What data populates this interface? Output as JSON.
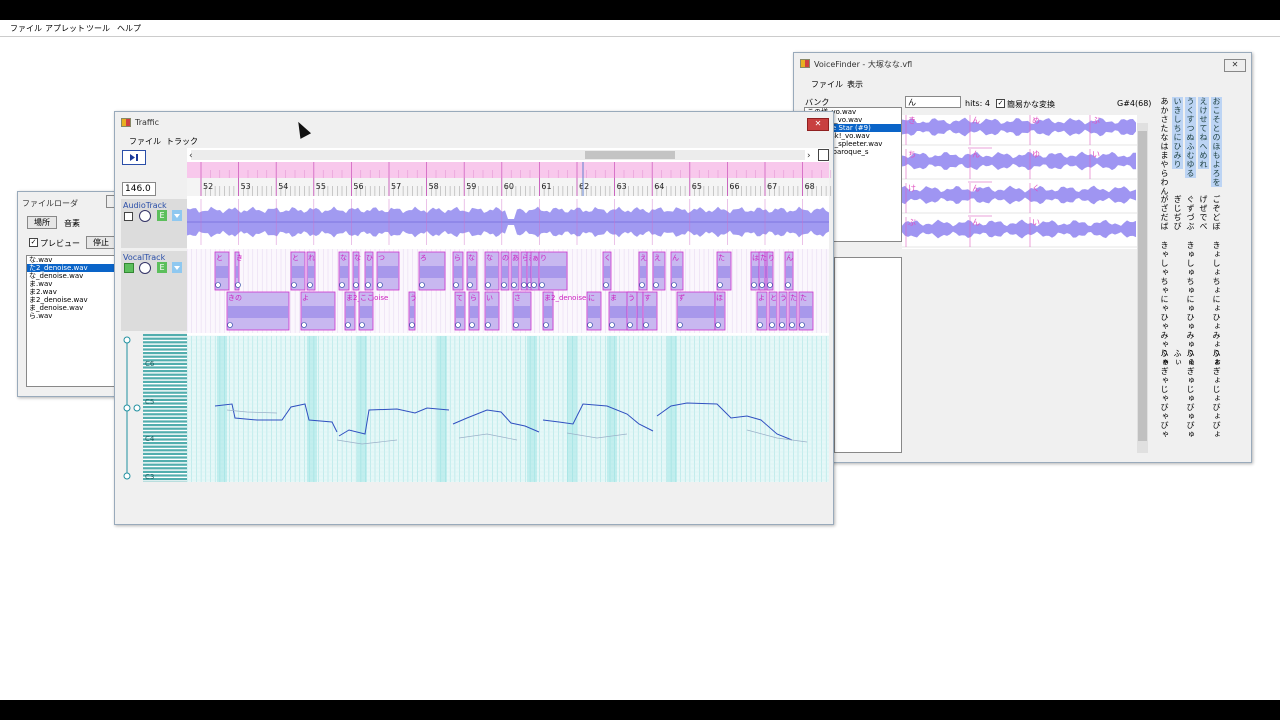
{
  "menubar": {
    "items": [
      "ファイル",
      "アプレット",
      "ツール",
      "ヘルプ"
    ]
  },
  "fileloader": {
    "title": "ファイルローダ",
    "close": "✕",
    "location_button": "場所",
    "music_label": "音素",
    "preview_label": "プレビュー",
    "stop_button": "停止",
    "files": [
      "な.wav",
      "た2_denoise.wav",
      "な_denoise.wav",
      "ま.wav",
      "ま2.wav",
      "ま2_denoise.wav",
      "ま_denoise.wav",
      "ら.wav"
    ]
  },
  "traffic": {
    "title": "Traffic",
    "close": "✕",
    "menu": [
      "ファイル",
      "トラック"
    ],
    "play_icon": "play-icon",
    "tempo": "146.0",
    "ruler_top": [
      "52",
      "53",
      "54",
      "55",
      "56",
      "57",
      "58",
      "59",
      "60",
      "61",
      "62",
      "63",
      "64",
      "65",
      "66",
      "67",
      "68"
    ],
    "bars": [
      "52",
      "53",
      "54",
      "55",
      "56",
      "57",
      "58",
      "59",
      "60",
      "61",
      "62",
      "63",
      "64",
      "65",
      "66",
      "67",
      "68"
    ],
    "audio_track": {
      "name": "AudioTrack",
      "e_button": "E"
    },
    "vocal_track": {
      "name": "VocalTrack",
      "e_button": "E"
    },
    "pitch_labels": [
      "C6",
      "C5",
      "C4",
      "C3"
    ],
    "vocal_upper": [
      "と",
      "き",
      "と",
      "れ",
      "な",
      "な",
      "ひ",
      "つ",
      "ろ",
      "ら",
      "な",
      "な",
      "の",
      "あ",
      "ら",
      "ま2_",
      "ぁ",
      "り",
      "く",
      "え",
      "え",
      "ん",
      "た",
      "は",
      "た",
      "り",
      "ん"
    ],
    "vocal_lower": [
      "きの",
      "よ",
      "ま2_denoise",
      "ここ",
      "う",
      "て",
      "ら",
      "い",
      "さ",
      "ま2_denoise",
      "に",
      "ま",
      "う",
      "す",
      "ず",
      "ほ",
      "よ",
      "と",
      "う",
      "た",
      "た"
    ],
    "colors": {
      "wave": "#8e82f0",
      "note": "#a488e0",
      "note_border": "#cc33cc",
      "grid_pink": "#f8c8ec",
      "piano": "#7fc6c6"
    }
  },
  "voicefinder": {
    "title": "VoiceFinder - 大塚なな.vfl",
    "close": "✕",
    "menu": [
      "ファイル",
      "表示"
    ],
    "bank_label": "バンク",
    "bank_items": [
      "この様_vo.wav",
      "CREATE_vo.wav",
      "le to the Star (#9)",
      "みずwask!_vo.wav",
      "カーブ刀_spleeter.wav",
      "screen baroque_s"
    ],
    "bank_selected": 2,
    "search_value": "ん",
    "hits": "hits: 4",
    "kana_convert_label": "簡易かな変換",
    "note_value": "G#4(68)",
    "row_labels": [
      [
        "き",
        "ん",
        "め",
        "ぶ"
      ],
      [
        "ち",
        "ん",
        "ゆ",
        "い"
      ],
      [
        "け",
        "ん",
        "く"
      ],
      [
        "ぶ",
        "ん",
        "い"
      ]
    ],
    "kana_columns": [
      {
        "text": "あかさたなはまやらわん",
        "hl": false
      },
      {
        "text": "いきしちにひみり",
        "hl": true
      },
      {
        "text": "うくすつぬふむゆる",
        "hl": true
      },
      {
        "text": "えけせてねへめれ",
        "hl": true
      },
      {
        "text": "おこそとのほもよろを",
        "hl": true
      },
      {
        "text": "がざだば",
        "hl": false
      },
      {
        "text": "ぎじぢび",
        "hl": false
      },
      {
        "text": "ぐずづぶ",
        "hl": false
      },
      {
        "text": "げぜでべ",
        "hl": false
      },
      {
        "text": "ごぞどぼ",
        "hl": false
      },
      {
        "text": "きゃしゃちゃにゃひゃみゃりゃぎゃじゃびゃぴゃ",
        "hl": false
      },
      {
        "text": "きゅしゅちゅにゅひゅみゅりゅぎゅじゅびゅぴゅ",
        "hl": false
      },
      {
        "text": "きょしょちょにょひょみょりょぎょじょびょぴょ",
        "hl": false
      },
      {
        "text": "ふぁ",
        "hl": false
      },
      {
        "text": "ふぃ",
        "hl": false
      },
      {
        "text": "ふぇ",
        "hl": false
      },
      {
        "text": "ふぉ",
        "hl": false
      }
    ]
  }
}
